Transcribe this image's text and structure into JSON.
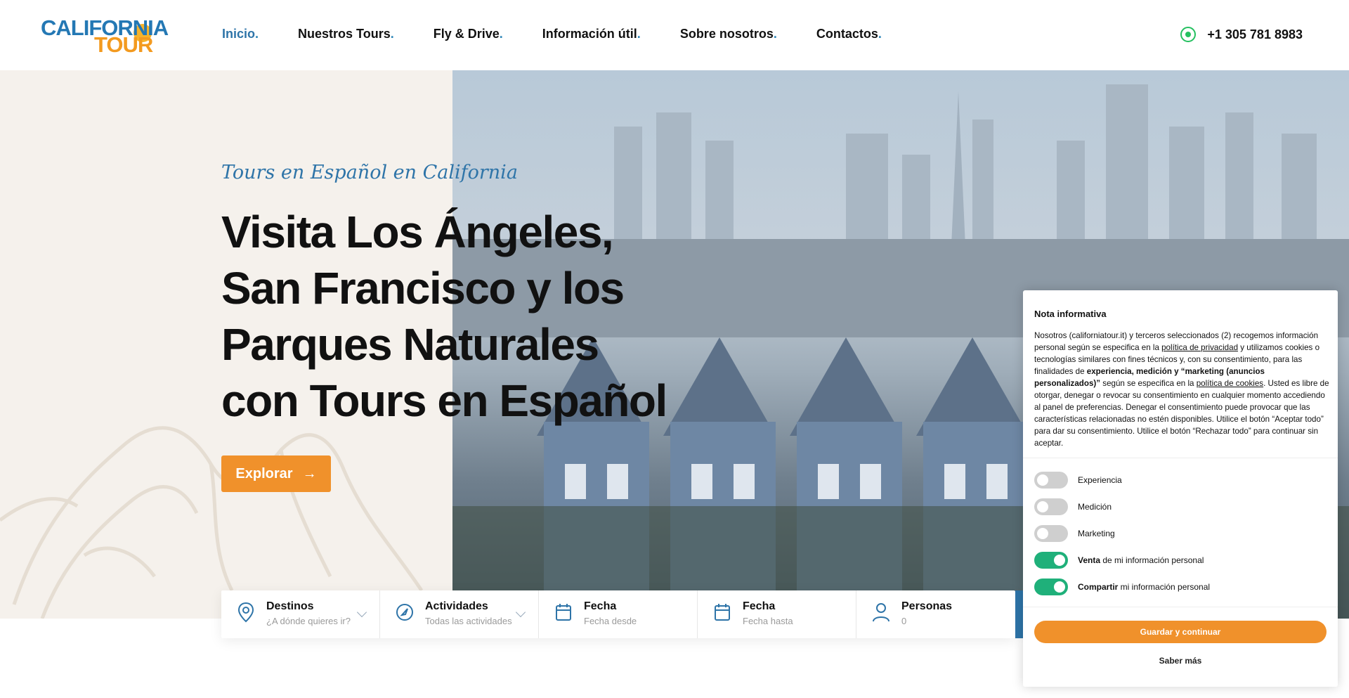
{
  "brand": {
    "line1": "CALIFORNIA",
    "line2": "TOUR"
  },
  "nav": [
    {
      "label": "Inicio",
      "dot": "."
    },
    {
      "label": "Nuestros Tours",
      "dot": "."
    },
    {
      "label": "Fly & Drive",
      "dot": "."
    },
    {
      "label": "Información útil",
      "dot": "."
    },
    {
      "label": "Sobre nosotros",
      "dot": "."
    },
    {
      "label": "Contactos",
      "dot": "."
    }
  ],
  "phone": "+1 305 781 8983",
  "hero": {
    "tagline": "Tours en Español en California",
    "title": "Visita Los Ángeles, San Francisco y los Parques Naturales con Tours en Español",
    "cta": "Explorar",
    "cta_icon": "→"
  },
  "search": [
    {
      "label": "Destinos",
      "sub": "¿A dónde quieres ir?",
      "icon": "location-pin-icon"
    },
    {
      "label": "Actividades",
      "sub": "Todas las actividades",
      "icon": "compass-icon"
    },
    {
      "label": "Fecha",
      "sub": "Fecha desde",
      "icon": "calendar-icon"
    },
    {
      "label": "Fecha",
      "sub": "Fecha hasta",
      "icon": "calendar-icon"
    },
    {
      "label": "Personas",
      "sub": "0",
      "icon": "person-icon"
    }
  ],
  "cookie": {
    "title": "Nota informativa",
    "text_parts": {
      "p1": "Nosotros (californiatour.it) y terceros seleccionados (2) recogemos información personal según se especifica en la ",
      "link1": "política de privacidad",
      "p2": " y utilizamos cookies o tecnologías similares con fines técnicos y, con su consentimiento, para las finalidades de ",
      "bold": "experiencia, medición y “marketing (anuncios personalizados)”",
      "p3": " según se especifica en la ",
      "link2": "política de cookies",
      "p4": ". Usted es libre de otorgar, denegar o revocar su consentimiento en cualquier momento accediendo al panel de preferencias. Denegar el consentimiento puede provocar que las características relacionadas no estén disponibles. Utilice el botón “Aceptar todo” para dar su consentimiento. Utilice el botón “Rechazar todo” para continuar sin aceptar."
    },
    "toggles": [
      {
        "bold": "",
        "label": "Experiencia",
        "on": false
      },
      {
        "bold": "",
        "label": "Medición",
        "on": false
      },
      {
        "bold": "",
        "label": "Marketing",
        "on": false
      },
      {
        "bold": "Venta",
        "label": " de mi información personal",
        "on": true
      },
      {
        "bold": "Compartir",
        "label": " mi información personal",
        "on": true
      }
    ],
    "save": "Guardar y continuar",
    "more": "Saber más"
  },
  "colors": {
    "accent": "#f0912b",
    "primary": "#2e74a8",
    "toggle_on": "#1fb07a",
    "whatsapp": "#25c060"
  }
}
